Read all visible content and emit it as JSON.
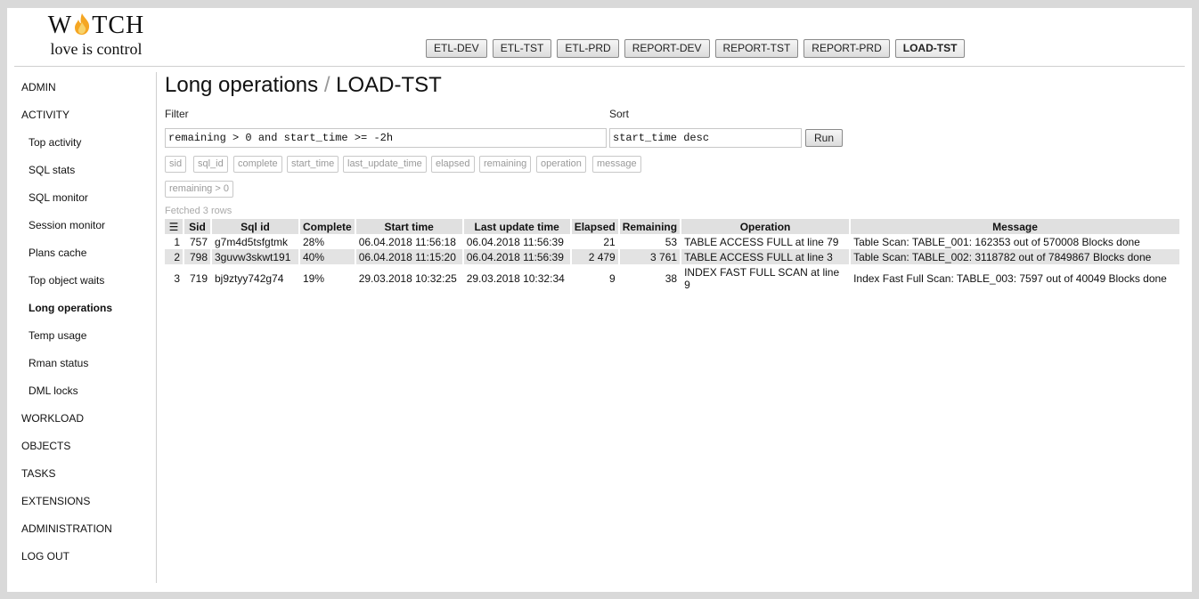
{
  "logo": {
    "brand_pre": "W",
    "brand_post": "TCH",
    "slogan": "love is control",
    "flame_color": "#f5a623"
  },
  "env_tabs": [
    {
      "label": "ETL-DEV",
      "active": false
    },
    {
      "label": "ETL-TST",
      "active": false
    },
    {
      "label": "ETL-PRD",
      "active": false
    },
    {
      "label": "REPORT-DEV",
      "active": false
    },
    {
      "label": "REPORT-TST",
      "active": false
    },
    {
      "label": "REPORT-PRD",
      "active": false
    },
    {
      "label": "LOAD-TST",
      "active": true
    }
  ],
  "sidebar": {
    "items": [
      {
        "label": "ADMIN"
      },
      {
        "label": "ACTIVITY"
      },
      {
        "label": "Top activity"
      },
      {
        "label": "SQL stats"
      },
      {
        "label": "SQL monitor"
      },
      {
        "label": "Session monitor"
      },
      {
        "label": "Plans cache"
      },
      {
        "label": "Top object waits"
      },
      {
        "label": "Long operations"
      },
      {
        "label": "Temp usage"
      },
      {
        "label": "Rman status"
      },
      {
        "label": "DML locks"
      },
      {
        "label": "WORKLOAD"
      },
      {
        "label": "OBJECTS"
      },
      {
        "label": "TASKS"
      },
      {
        "label": "EXTENSIONS"
      },
      {
        "label": "ADMINISTRATION"
      },
      {
        "label": "LOG OUT"
      }
    ]
  },
  "page": {
    "title": "Long operations",
    "separator": "/",
    "env": "LOAD-TST"
  },
  "filter": {
    "label": "Filter",
    "value": "remaining > 0 and start_time >= -2h"
  },
  "sort": {
    "label": "Sort",
    "value": "start_time desc"
  },
  "run_label": "Run",
  "chips": [
    "sid",
    "sql_id",
    "complete",
    "start_time",
    "last_update_time",
    "elapsed",
    "remaining",
    "operation",
    "message",
    "remaining > 0"
  ],
  "fetched": "Fetched 3 rows",
  "table": {
    "menu_icon": "☰",
    "headers": [
      "Sid",
      "Sql id",
      "Complete",
      "Start time",
      "Last update time",
      "Elapsed",
      "Remaining",
      "Operation",
      "Message"
    ],
    "rows": [
      [
        "1",
        "757",
        "g7m4d5tsfgtmk",
        "28%",
        "06.04.2018 11:56:18",
        "06.04.2018 11:56:39",
        "21",
        "53",
        "TABLE ACCESS FULL at line 79",
        "Table Scan: TABLE_001: 162353 out of 570008 Blocks done"
      ],
      [
        "2",
        "798",
        "3guvw3skwt191",
        "40%",
        "06.04.2018 11:15:20",
        "06.04.2018 11:56:39",
        "2 479",
        "3 761",
        "TABLE ACCESS FULL at line 3",
        "Table Scan: TABLE_002: 3118782 out of 7849867 Blocks done"
      ],
      [
        "3",
        "719",
        "bj9ztyy742g74",
        "19%",
        "29.03.2018 10:32:25",
        "29.03.2018 10:32:34",
        "9",
        "38",
        "INDEX FAST FULL SCAN at line 9",
        "Index Fast Full Scan: TABLE_003: 7597 out of 40049 Blocks done"
      ]
    ]
  }
}
